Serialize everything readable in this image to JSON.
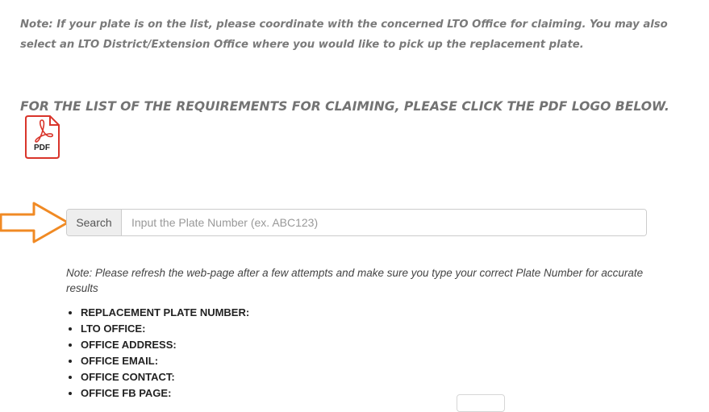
{
  "note_top": "Note: If your plate is on the list, please coordinate with the concerned LTO Office for claiming. You may also select an LTO District/Extension Office where you would like to pick up the replacement plate.",
  "heading": "FOR THE LIST OF THE REQUIREMENTS FOR CLAIMING, PLEASE CLICK THE PDF LOGO BELOW.",
  "pdf_logo": {
    "label": "PDF",
    "icon": "pdf-icon",
    "color": "#d9352b"
  },
  "arrow": {
    "icon": "arrow-right-icon",
    "color": "#f08a24"
  },
  "search": {
    "button_label": "Search",
    "placeholder": "Input the Plate Number (ex. ABC123)",
    "value": ""
  },
  "note_bottom": "Note: Please refresh the web-page after a few attempts and make sure you type your correct Plate Number for accurate results",
  "result_fields": [
    "REPLACEMENT PLATE NUMBER:",
    "LTO OFFICE:",
    "OFFICE ADDRESS:",
    "OFFICE EMAIL:",
    "OFFICE CONTACT:",
    "OFFICE FB PAGE:"
  ]
}
